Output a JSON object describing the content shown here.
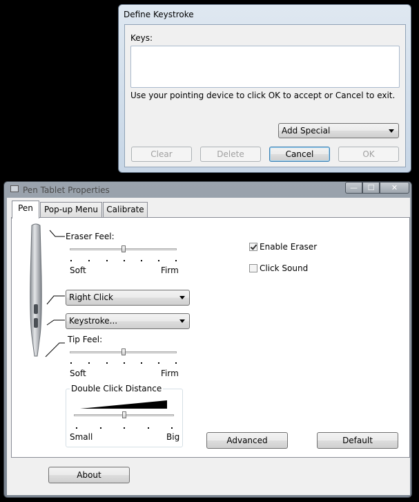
{
  "define_keystroke": {
    "title": "Define Keystroke",
    "keys_label": "Keys:",
    "keys_value": "",
    "instruction": "Use your pointing device to click OK to accept or Cancel to exit.",
    "add_special": "Add Special",
    "buttons": {
      "clear": "Clear",
      "delete": "Delete",
      "cancel": "Cancel",
      "ok": "OK"
    }
  },
  "pen_tablet": {
    "title": "Pen Tablet Properties",
    "controls": {
      "minimize": "—",
      "maximize": "☐",
      "close": "✕"
    },
    "tabs": [
      "Pen",
      "Pop-up Menu",
      "Calibrate"
    ],
    "eraser_feel": {
      "label": "Eraser Feel:",
      "min": "Soft",
      "max": "Firm",
      "level": 0.5
    },
    "side_button_upper": "Right Click",
    "side_button_lower": "Keystroke...",
    "tip_feel": {
      "label": "Tip Feel:",
      "min": "Soft",
      "max": "Firm",
      "level": 0.5
    },
    "double_click": {
      "label": "Double Click Distance",
      "min": "Small",
      "max": "Big",
      "level": 0.5
    },
    "enable_eraser": {
      "label": "Enable Eraser",
      "checked": true
    },
    "click_sound": {
      "label": "Click Sound",
      "checked": false
    },
    "advanced": "Advanced",
    "default": "Default",
    "about": "About"
  }
}
